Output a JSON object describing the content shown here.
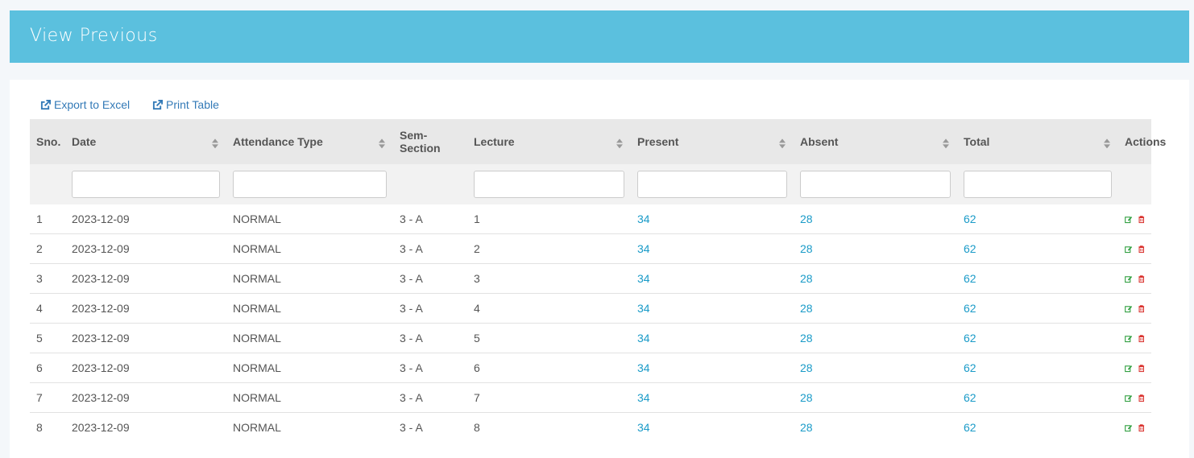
{
  "header": {
    "title": "View Previous"
  },
  "toolbar": {
    "export_label": "Export to Excel",
    "print_label": "Print Table"
  },
  "table": {
    "columns": [
      "Sno.",
      "Date",
      "Attendance Type",
      "Sem-Section",
      "Lecture",
      "Present",
      "Absent",
      "Total",
      "Actions"
    ],
    "rows": [
      {
        "sno": "1",
        "date": "2023-12-09",
        "type": "NORMAL",
        "section": "3 - A",
        "lecture": "1",
        "present": "34",
        "absent": "28",
        "total": "62"
      },
      {
        "sno": "2",
        "date": "2023-12-09",
        "type": "NORMAL",
        "section": "3 - A",
        "lecture": "2",
        "present": "34",
        "absent": "28",
        "total": "62"
      },
      {
        "sno": "3",
        "date": "2023-12-09",
        "type": "NORMAL",
        "section": "3 - A",
        "lecture": "3",
        "present": "34",
        "absent": "28",
        "total": "62"
      },
      {
        "sno": "4",
        "date": "2023-12-09",
        "type": "NORMAL",
        "section": "3 - A",
        "lecture": "4",
        "present": "34",
        "absent": "28",
        "total": "62"
      },
      {
        "sno": "5",
        "date": "2023-12-09",
        "type": "NORMAL",
        "section": "3 - A",
        "lecture": "5",
        "present": "34",
        "absent": "28",
        "total": "62"
      },
      {
        "sno": "6",
        "date": "2023-12-09",
        "type": "NORMAL",
        "section": "3 - A",
        "lecture": "6",
        "present": "34",
        "absent": "28",
        "total": "62"
      },
      {
        "sno": "7",
        "date": "2023-12-09",
        "type": "NORMAL",
        "section": "3 - A",
        "lecture": "7",
        "present": "34",
        "absent": "28",
        "total": "62"
      },
      {
        "sno": "8",
        "date": "2023-12-09",
        "type": "NORMAL",
        "section": "3 - A",
        "lecture": "8",
        "present": "34",
        "absent": "28",
        "total": "62"
      }
    ]
  },
  "icons": {
    "export": "external-link-icon",
    "print": "external-link-icon",
    "sort": "sort-icon",
    "edit": "edit-icon",
    "delete": "trash-icon"
  },
  "colors": {
    "header_bg": "#5bc0de",
    "link": "#1a9bc8",
    "toolbar_link": "#337ab7",
    "edit": "#2e9e3e",
    "delete": "#d9302c"
  }
}
